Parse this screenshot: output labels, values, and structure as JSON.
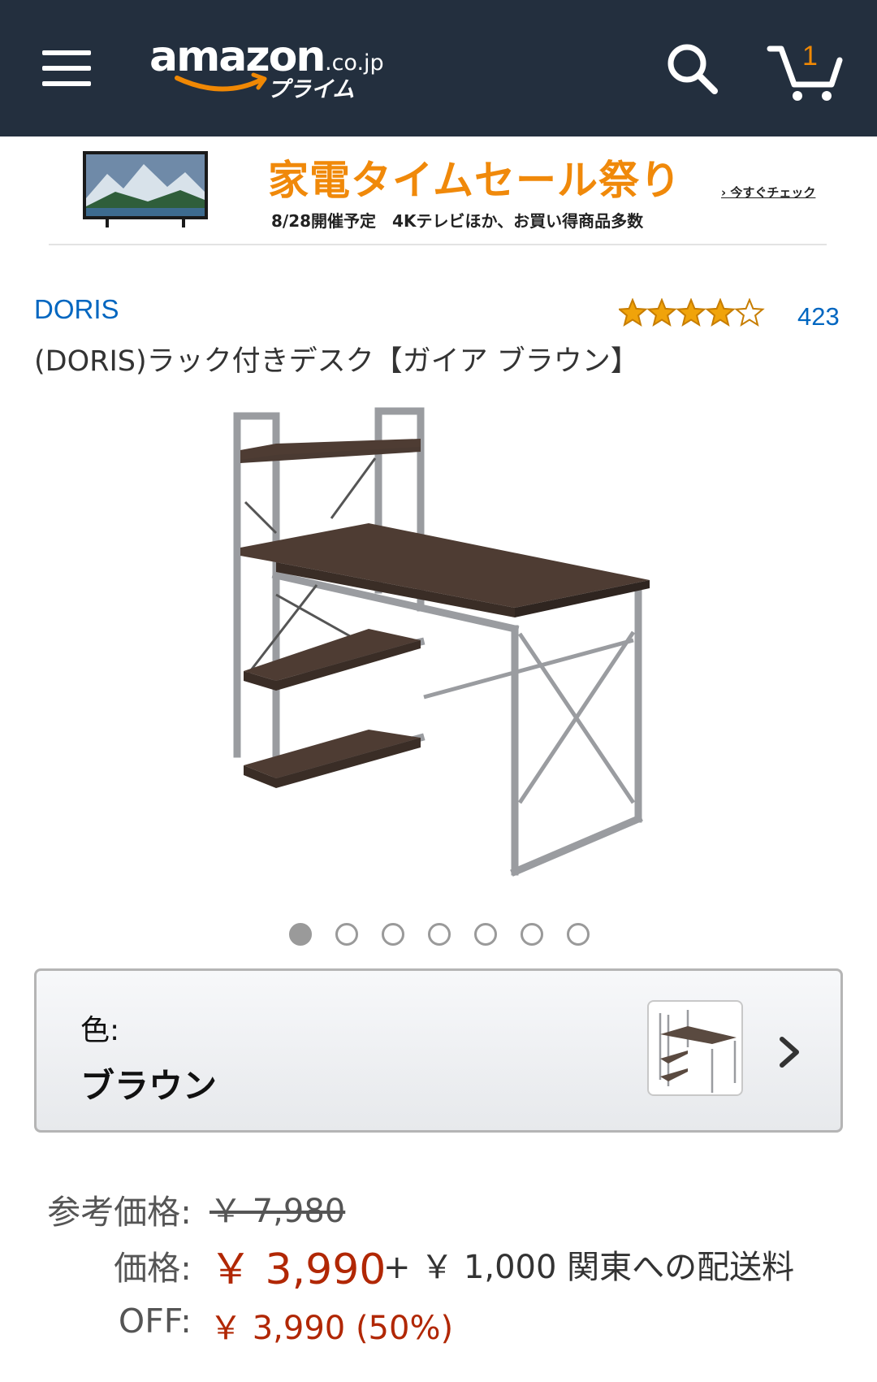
{
  "header": {
    "logo_word": "amazon",
    "logo_domain": ".co.jp",
    "logo_prime": "プライム",
    "cart_count": "1"
  },
  "banner": {
    "headline": "家電タイムセール祭り",
    "subtext": "8/28開催予定　4Kテレビほか、お買い得商品多数",
    "link": "› 今すぐチェック"
  },
  "product": {
    "brand": "DORIS",
    "title": "(DORIS)ラック付きデスク【ガイア ブラウン】",
    "rating": 4,
    "rating_max": 5,
    "review_count": "423",
    "image_count": 7,
    "active_image": 1
  },
  "variation": {
    "label": "色:",
    "value": "ブラウン"
  },
  "prices": {
    "list_label": "参考価格:",
    "list_price": "￥ 7,980",
    "price_label": "価格:",
    "price": "￥ 3,990",
    "shipping": "+ ￥ 1,000 関東への配送料",
    "off_label": "OFF:",
    "off_value": "￥ 3,990 (50%)"
  },
  "colors": {
    "header_bg": "#232f3e",
    "accent_orange": "#f08804",
    "link_blue": "#0066c0",
    "price_red": "#b12704",
    "star_gold": "#f0a30a"
  }
}
